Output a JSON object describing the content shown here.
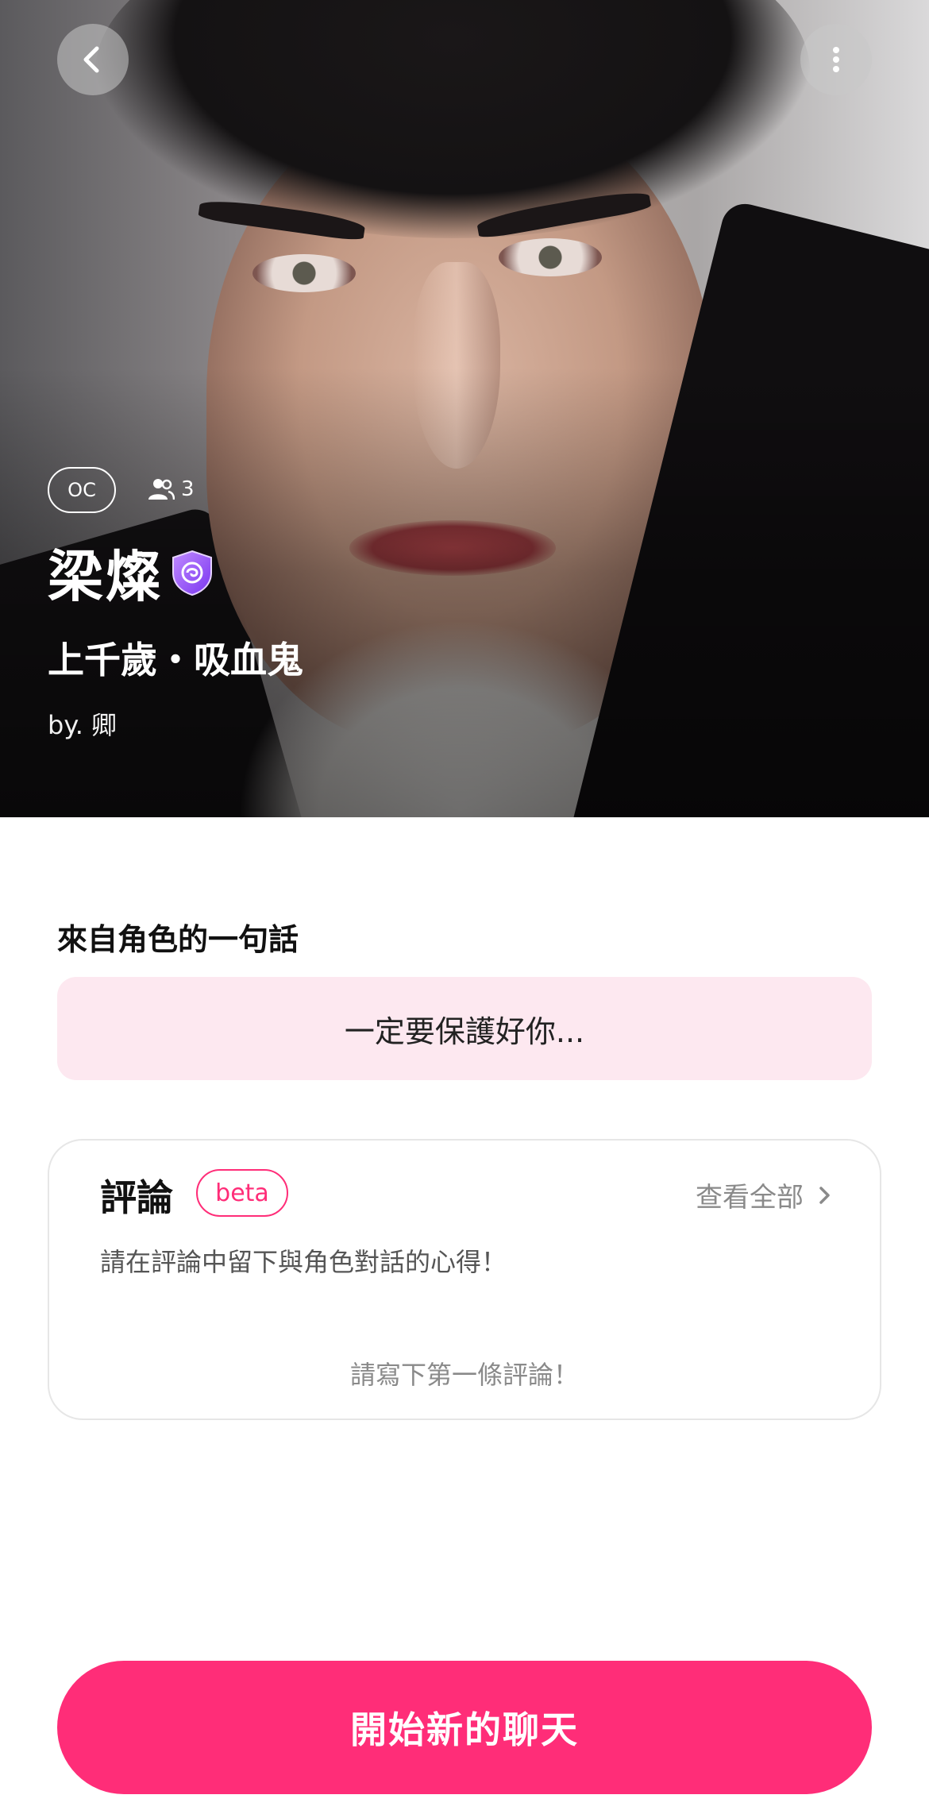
{
  "hero": {
    "tag": "OC",
    "user_count": "3",
    "name": "梁燦",
    "subtitle": "上千歲・吸血鬼",
    "author": "by. 卿"
  },
  "icons": {
    "back": "chevron-left-icon",
    "more": "more-vertical-icon",
    "users": "users-icon",
    "verified": "verified-shield-icon",
    "view_all": "chevron-right-icon"
  },
  "quote": {
    "label": "來自角色的一句話",
    "text": "一定要保護好你..."
  },
  "reviews": {
    "title": "評論",
    "badge": "beta",
    "view_all": "查看全部",
    "hint": "請在評論中留下與角色對話的心得！",
    "empty": "請寫下第一條評論！"
  },
  "cta": {
    "label": "開始新的聊天"
  },
  "colors": {
    "accent": "#ff2d78",
    "quote_bg": "#fde8f0",
    "verified": "#8a4bff"
  }
}
